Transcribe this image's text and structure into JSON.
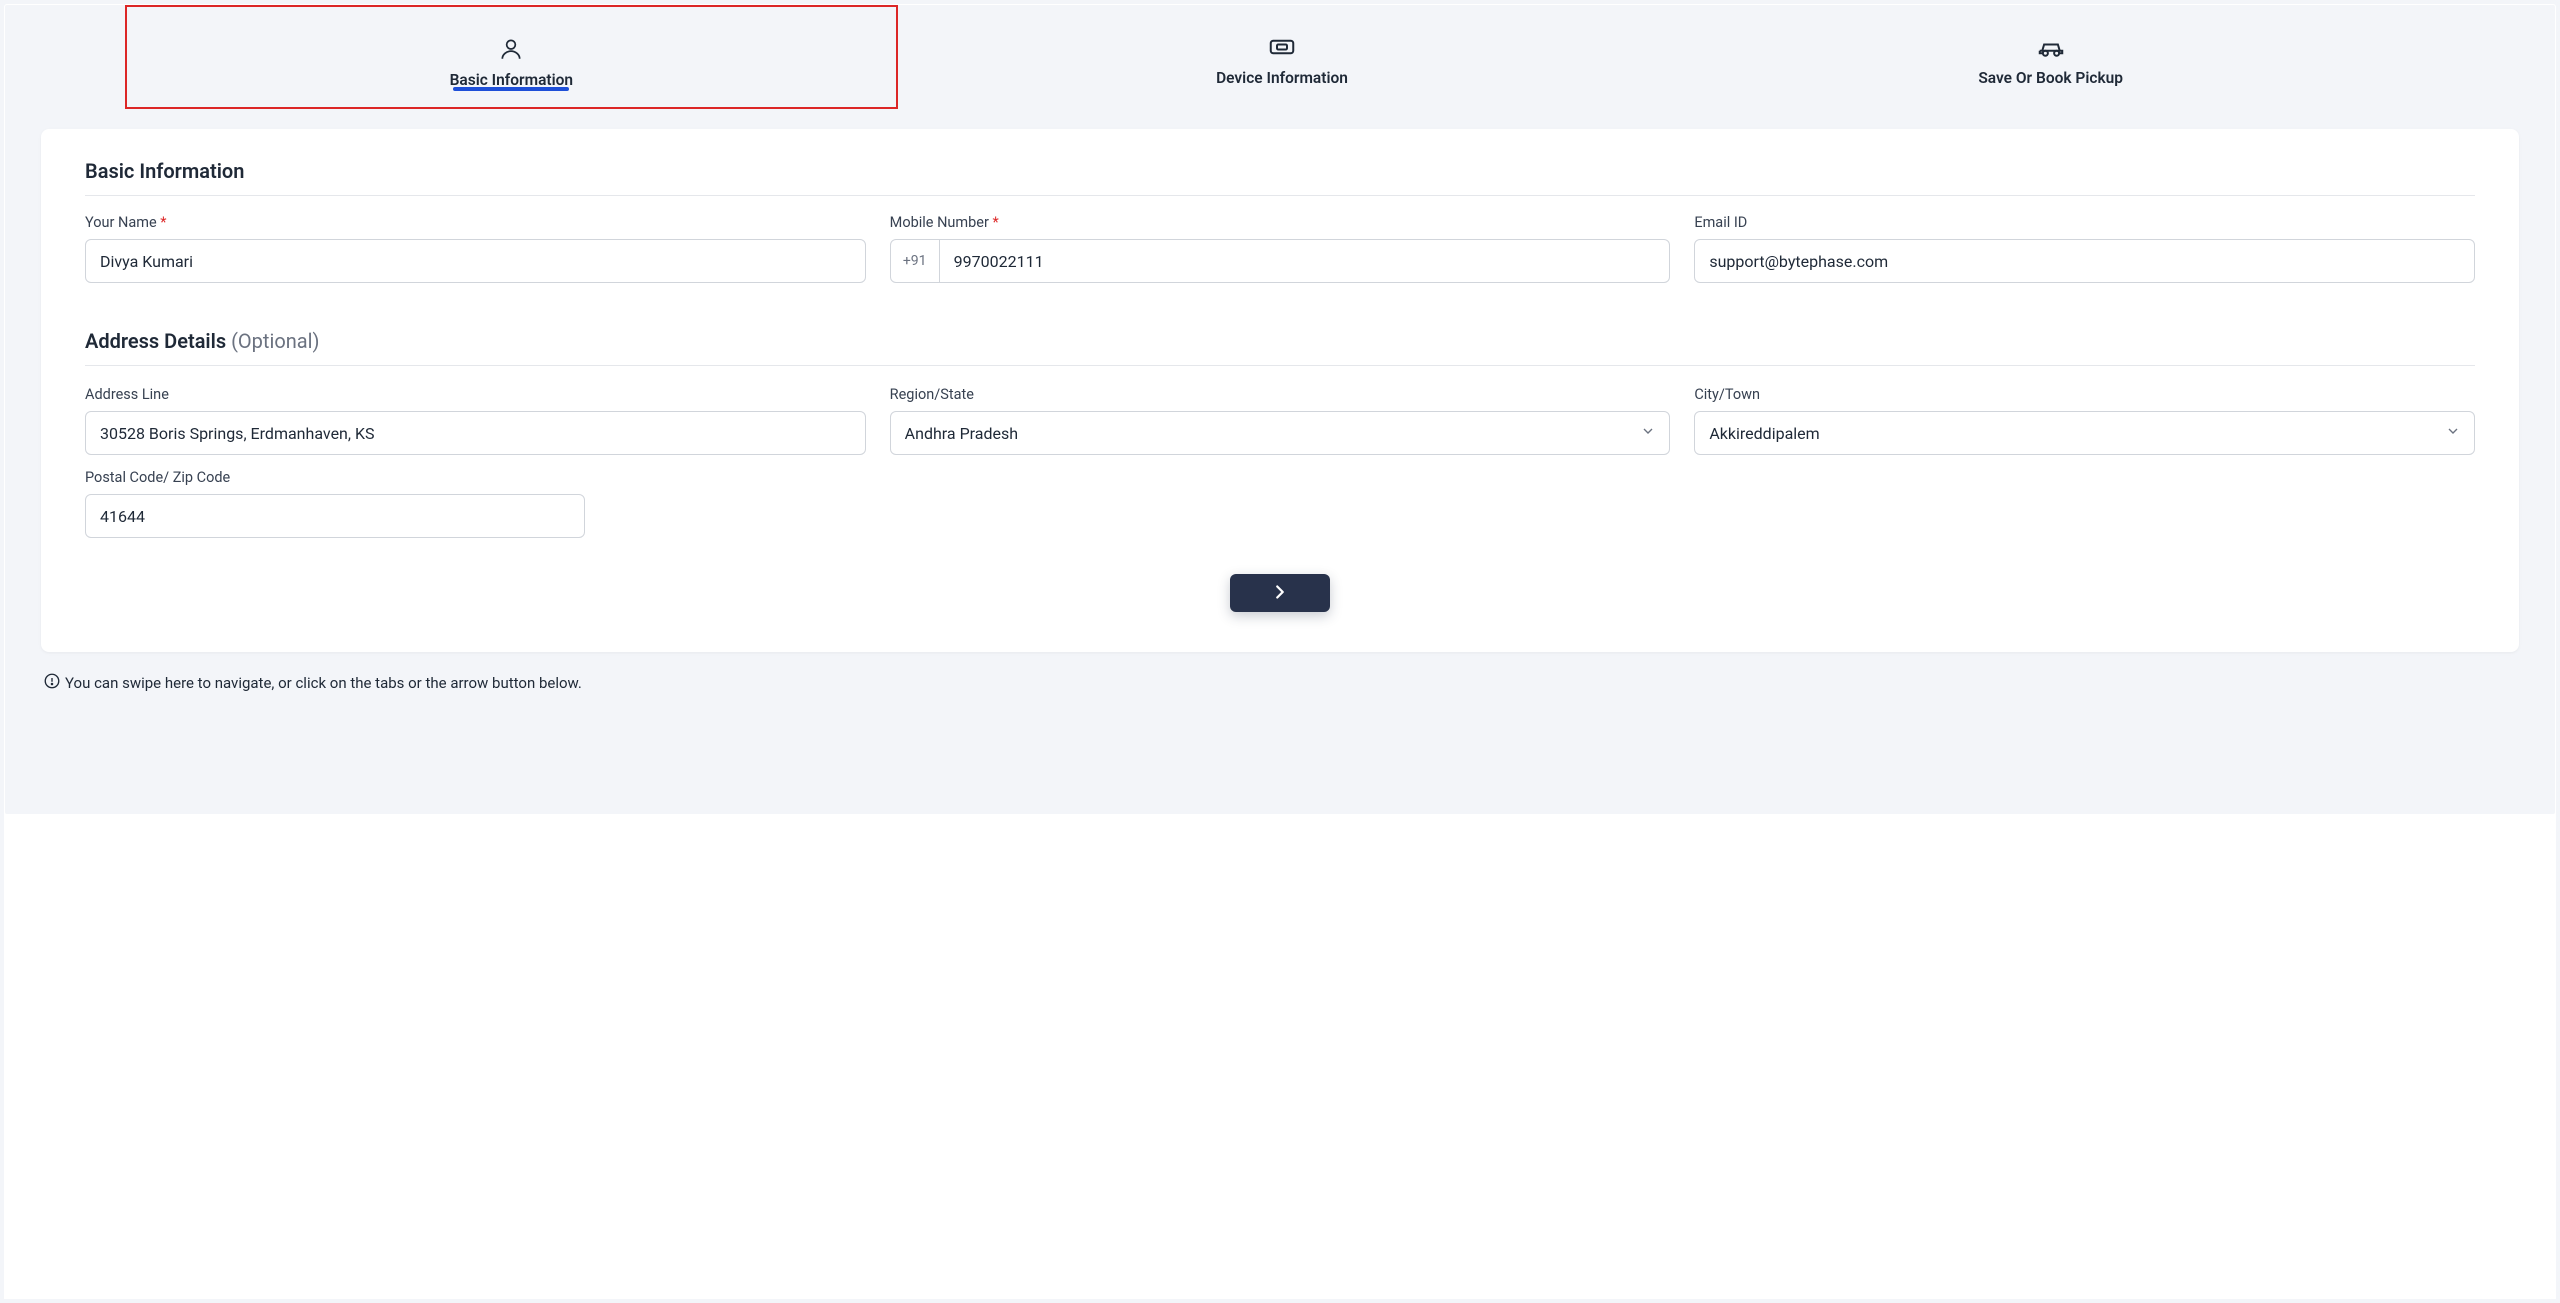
{
  "tabs": {
    "basic": "Basic Information",
    "device": "Device Information",
    "save": "Save Or Book Pickup"
  },
  "section1": {
    "title": "Basic Information",
    "name_label": "Your Name ",
    "name_value": "Divya Kumari",
    "mobile_label": "Mobile Number ",
    "mobile_prefix": "+91",
    "mobile_value": "9970022111",
    "email_label": "Email ID",
    "email_value": "support@bytephase.com"
  },
  "section2": {
    "title": "Address Details ",
    "optional": "(Optional)",
    "address_label": "Address Line",
    "address_value": "30528 Boris Springs, Erdmanhaven, KS",
    "region_label": "Region/State",
    "region_value": "Andhra Pradesh",
    "city_label": "City/Town",
    "city_value": "Akkireddipalem",
    "postal_label": "Postal Code/ Zip Code",
    "postal_value": "41644"
  },
  "hint": "You can swipe here to navigate, or click on the tabs or the arrow button below."
}
